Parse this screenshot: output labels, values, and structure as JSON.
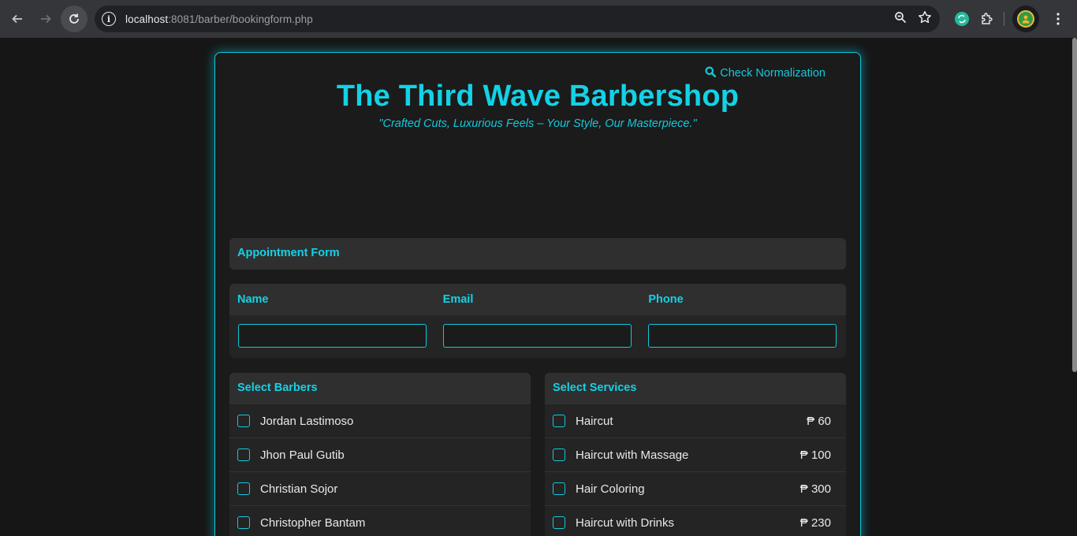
{
  "browser": {
    "url_host": "localhost",
    "url_rest": ":8081/barber/bookingform.php"
  },
  "header": {
    "check_link": "Check Normalization",
    "title": "The Third Wave Barbershop",
    "tagline": "\"Crafted Cuts, Luxurious Feels – Your Style, Our Masterpiece.\""
  },
  "appointment": {
    "title": "Appointment Form"
  },
  "fields": {
    "name_label": "Name",
    "email_label": "Email",
    "phone_label": "Phone"
  },
  "barbers": {
    "title": "Select Barbers",
    "items": [
      {
        "name": "Jordan Lastimoso"
      },
      {
        "name": "Jhon Paul Gutib"
      },
      {
        "name": "Christian Sojor"
      },
      {
        "name": "Christopher Bantam"
      }
    ]
  },
  "services": {
    "title": "Select Services",
    "items": [
      {
        "name": "Haircut",
        "price": "₱ 60"
      },
      {
        "name": "Haircut with Massage",
        "price": "₱ 100"
      },
      {
        "name": "Hair Coloring",
        "price": "₱ 300"
      },
      {
        "name": "Haircut with Drinks",
        "price": "₱ 230"
      }
    ]
  },
  "colors": {
    "accent": "#12d2e6",
    "background": "#161616",
    "panel": "#242424"
  }
}
